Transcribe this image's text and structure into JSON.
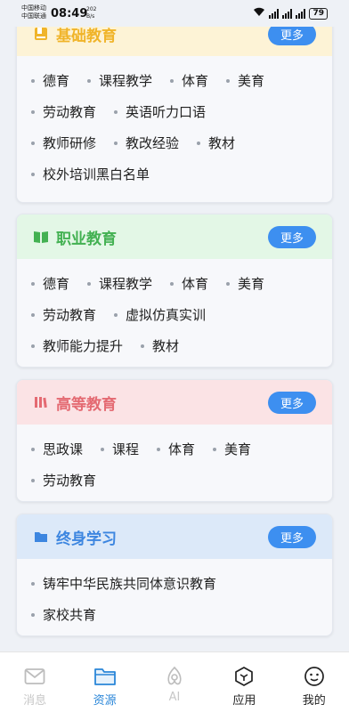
{
  "statusbar": {
    "carrier1": "中国移动",
    "carrier2": "中国联通",
    "time": "08:49",
    "speed_value": "202",
    "speed_unit": "B/s",
    "battery": "79"
  },
  "sections": [
    {
      "title": "基础教育",
      "more": "更多",
      "color": "#f0b429",
      "rows": [
        [
          "德育",
          "课程教学",
          "体育",
          "美育"
        ],
        [
          "劳动教育",
          "英语听力口语"
        ],
        [
          "教师研修",
          "教改经验",
          "教材"
        ],
        [
          "校外培训黑白名单"
        ]
      ]
    },
    {
      "title": "职业教育",
      "more": "更多",
      "color": "#43b152",
      "rows": [
        [
          "德育",
          "课程教学",
          "体育",
          "美育"
        ],
        [
          "劳动教育",
          "虚拟仿真实训"
        ],
        [
          "教师能力提升",
          "教材"
        ]
      ]
    },
    {
      "title": "高等教育",
      "more": "更多",
      "color": "#e46a72",
      "rows": [
        [
          "思政课",
          "课程",
          "体育",
          "美育"
        ],
        [
          "劳动教育"
        ]
      ]
    },
    {
      "title": "终身学习",
      "more": "更多",
      "color": "#3d86e0",
      "rows": [
        [
          "铸牢中华民族共同体意识教育"
        ],
        [
          "家校共育"
        ]
      ]
    }
  ],
  "tabbar": [
    {
      "label": "消息",
      "icon": "mail-icon"
    },
    {
      "label": "资源",
      "icon": "folder-icon"
    },
    {
      "label": "AI",
      "icon": "ai-icon"
    },
    {
      "label": "应用",
      "icon": "cube-icon"
    },
    {
      "label": "我的",
      "icon": "smile-icon"
    }
  ]
}
